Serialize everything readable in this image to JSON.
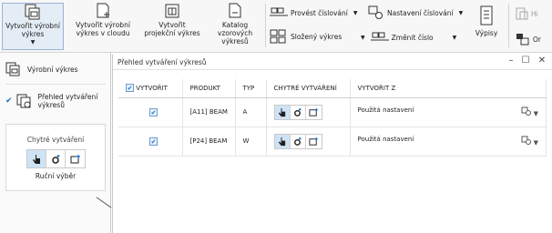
{
  "ribbon": {
    "create_production": "Vytvořit výrobní výkres",
    "create_production_cloud": "Vytvořit výrobní výkres v cloudu",
    "create_project": "Vytvořit projekční výkres",
    "catalog": "Katalog vzorových výkresů",
    "numbering_run": "Provést číslování",
    "composite": "Složený výkres",
    "numbering_settings": "Nastavení číslování",
    "change_number": "Změnit číslo",
    "lists": "Výpisy",
    "hi_cut": "Hi",
    "or_cut": "Or"
  },
  "dropdown": {
    "item1": "Výrobní výkres",
    "item2_line1": "Přehled vytváření",
    "item2_line2": "výkresů",
    "group_title": "Chytré vytváření",
    "group_sub": "Ruční výběr"
  },
  "dialog": {
    "title": "Přehled vytváření výkresů",
    "minimize": "–",
    "maximize": "☐",
    "close": "✕",
    "columns": [
      "VYTVOŘIT",
      "PRODUKT",
      "TYP",
      "CHYTRÉ VYTVÁŘENÍ",
      "VYTVOŘIT Z"
    ],
    "rows": [
      {
        "product": "[A11] BEAM",
        "type": "A",
        "source": "Použitá nastavení"
      },
      {
        "product": "[P24] BEAM",
        "type": "W",
        "source": "Použitá nastavení"
      }
    ]
  },
  "icons": {
    "check": "✔"
  }
}
